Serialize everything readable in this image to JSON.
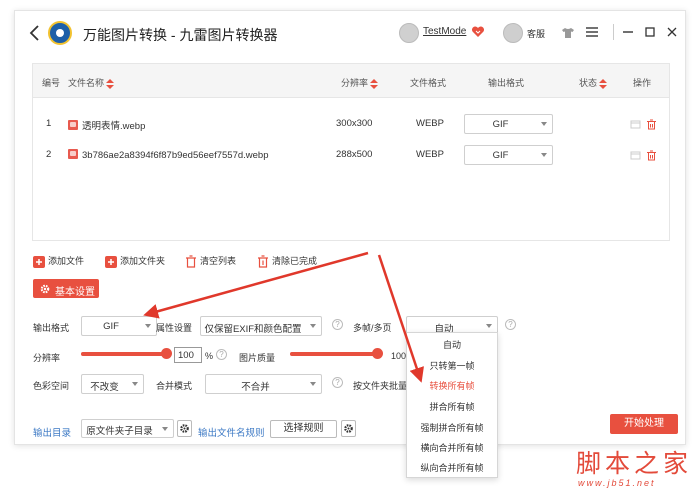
{
  "titlebar": {
    "app_title": "万能图片转换 - 九雷图片转换器",
    "username": "TestMode",
    "service_label": "客服"
  },
  "table": {
    "headers": {
      "index": "编号",
      "filename": "文件名称",
      "resolution": "分辨率",
      "format": "文件格式",
      "output": "输出格式",
      "status": "状态",
      "action": "操作"
    },
    "rows": [
      {
        "index": "1",
        "name": "透明表情.webp",
        "resolution": "300x300",
        "format": "WEBP",
        "output": "GIF"
      },
      {
        "index": "2",
        "name": "3b786ae2a8394f6f87b9ed56eef7557d.webp",
        "resolution": "288x500",
        "format": "WEBP",
        "output": "GIF"
      }
    ]
  },
  "toolbar": {
    "add_file": "添加文件",
    "add_folder": "添加文件夹",
    "clear_list": "清空列表",
    "clear_done": "清除已完成",
    "basic_settings": "基本设置"
  },
  "settings": {
    "output_format_label": "输出格式",
    "output_format_value": "GIF",
    "attr_label": "属性设置",
    "attr_value": "仅保留EXIF和颜色配置",
    "multiframe_label": "多帧/多页",
    "multiframe_value": "自动",
    "resolution_label": "分辨率",
    "resolution_value": "100",
    "resolution_unit": "%",
    "resolution_percent": 100,
    "quality_label": "图片质量",
    "quality_value": "100",
    "quality_percent": 100,
    "colorspace_label": "色彩空间",
    "colorspace_value": "不改变",
    "merge_label": "合并模式",
    "merge_value": "不合并",
    "folder_batch_label": "按文件夹批量合"
  },
  "footer": {
    "output_dir_label": "输出目录",
    "output_dir_value": "原文件夹子目录",
    "filename_rule_label": "输出文件名规则",
    "rule_button": "选择规则",
    "start_button": "开始处理"
  },
  "dropdown": {
    "items": [
      "自动",
      "只转第一帧",
      "转换所有帧",
      "拼合所有帧",
      "强制拼合所有帧",
      "横向合并所有帧",
      "纵向合并所有帧"
    ],
    "active_index": 2
  },
  "watermark": {
    "cn": "脚本之家",
    "url": "www.jb51.net"
  },
  "colors": {
    "accent": "#e8503f",
    "link": "#3b78c4",
    "arrow": "#e0382b"
  }
}
